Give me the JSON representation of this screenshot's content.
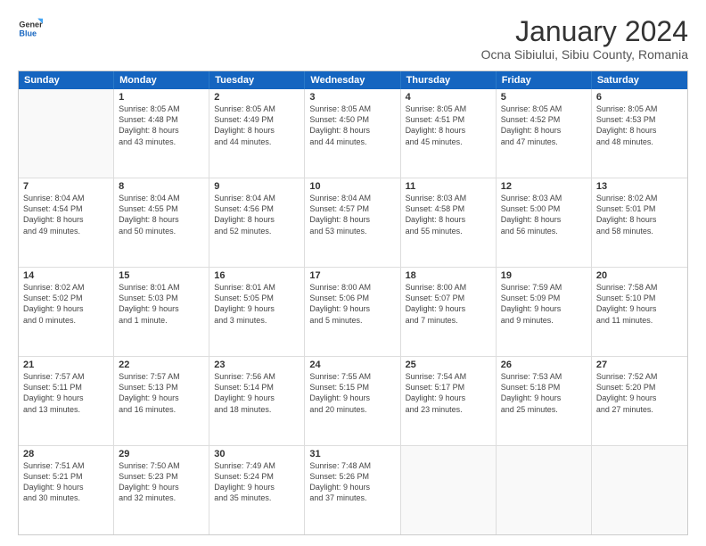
{
  "header": {
    "logo_line1": "General",
    "logo_line2": "Blue",
    "main_title": "January 2024",
    "subtitle": "Ocna Sibiului, Sibiu County, Romania"
  },
  "calendar": {
    "days_of_week": [
      "Sunday",
      "Monday",
      "Tuesday",
      "Wednesday",
      "Thursday",
      "Friday",
      "Saturday"
    ],
    "rows": [
      [
        {
          "day": "",
          "text": ""
        },
        {
          "day": "1",
          "text": "Sunrise: 8:05 AM\nSunset: 4:48 PM\nDaylight: 8 hours\nand 43 minutes."
        },
        {
          "day": "2",
          "text": "Sunrise: 8:05 AM\nSunset: 4:49 PM\nDaylight: 8 hours\nand 44 minutes."
        },
        {
          "day": "3",
          "text": "Sunrise: 8:05 AM\nSunset: 4:50 PM\nDaylight: 8 hours\nand 44 minutes."
        },
        {
          "day": "4",
          "text": "Sunrise: 8:05 AM\nSunset: 4:51 PM\nDaylight: 8 hours\nand 45 minutes."
        },
        {
          "day": "5",
          "text": "Sunrise: 8:05 AM\nSunset: 4:52 PM\nDaylight: 8 hours\nand 47 minutes."
        },
        {
          "day": "6",
          "text": "Sunrise: 8:05 AM\nSunset: 4:53 PM\nDaylight: 8 hours\nand 48 minutes."
        }
      ],
      [
        {
          "day": "7",
          "text": "Sunrise: 8:04 AM\nSunset: 4:54 PM\nDaylight: 8 hours\nand 49 minutes."
        },
        {
          "day": "8",
          "text": "Sunrise: 8:04 AM\nSunset: 4:55 PM\nDaylight: 8 hours\nand 50 minutes."
        },
        {
          "day": "9",
          "text": "Sunrise: 8:04 AM\nSunset: 4:56 PM\nDaylight: 8 hours\nand 52 minutes."
        },
        {
          "day": "10",
          "text": "Sunrise: 8:04 AM\nSunset: 4:57 PM\nDaylight: 8 hours\nand 53 minutes."
        },
        {
          "day": "11",
          "text": "Sunrise: 8:03 AM\nSunset: 4:58 PM\nDaylight: 8 hours\nand 55 minutes."
        },
        {
          "day": "12",
          "text": "Sunrise: 8:03 AM\nSunset: 5:00 PM\nDaylight: 8 hours\nand 56 minutes."
        },
        {
          "day": "13",
          "text": "Sunrise: 8:02 AM\nSunset: 5:01 PM\nDaylight: 8 hours\nand 58 minutes."
        }
      ],
      [
        {
          "day": "14",
          "text": "Sunrise: 8:02 AM\nSunset: 5:02 PM\nDaylight: 9 hours\nand 0 minutes."
        },
        {
          "day": "15",
          "text": "Sunrise: 8:01 AM\nSunset: 5:03 PM\nDaylight: 9 hours\nand 1 minute."
        },
        {
          "day": "16",
          "text": "Sunrise: 8:01 AM\nSunset: 5:05 PM\nDaylight: 9 hours\nand 3 minutes."
        },
        {
          "day": "17",
          "text": "Sunrise: 8:00 AM\nSunset: 5:06 PM\nDaylight: 9 hours\nand 5 minutes."
        },
        {
          "day": "18",
          "text": "Sunrise: 8:00 AM\nSunset: 5:07 PM\nDaylight: 9 hours\nand 7 minutes."
        },
        {
          "day": "19",
          "text": "Sunrise: 7:59 AM\nSunset: 5:09 PM\nDaylight: 9 hours\nand 9 minutes."
        },
        {
          "day": "20",
          "text": "Sunrise: 7:58 AM\nSunset: 5:10 PM\nDaylight: 9 hours\nand 11 minutes."
        }
      ],
      [
        {
          "day": "21",
          "text": "Sunrise: 7:57 AM\nSunset: 5:11 PM\nDaylight: 9 hours\nand 13 minutes."
        },
        {
          "day": "22",
          "text": "Sunrise: 7:57 AM\nSunset: 5:13 PM\nDaylight: 9 hours\nand 16 minutes."
        },
        {
          "day": "23",
          "text": "Sunrise: 7:56 AM\nSunset: 5:14 PM\nDaylight: 9 hours\nand 18 minutes."
        },
        {
          "day": "24",
          "text": "Sunrise: 7:55 AM\nSunset: 5:15 PM\nDaylight: 9 hours\nand 20 minutes."
        },
        {
          "day": "25",
          "text": "Sunrise: 7:54 AM\nSunset: 5:17 PM\nDaylight: 9 hours\nand 23 minutes."
        },
        {
          "day": "26",
          "text": "Sunrise: 7:53 AM\nSunset: 5:18 PM\nDaylight: 9 hours\nand 25 minutes."
        },
        {
          "day": "27",
          "text": "Sunrise: 7:52 AM\nSunset: 5:20 PM\nDaylight: 9 hours\nand 27 minutes."
        }
      ],
      [
        {
          "day": "28",
          "text": "Sunrise: 7:51 AM\nSunset: 5:21 PM\nDaylight: 9 hours\nand 30 minutes."
        },
        {
          "day": "29",
          "text": "Sunrise: 7:50 AM\nSunset: 5:23 PM\nDaylight: 9 hours\nand 32 minutes."
        },
        {
          "day": "30",
          "text": "Sunrise: 7:49 AM\nSunset: 5:24 PM\nDaylight: 9 hours\nand 35 minutes."
        },
        {
          "day": "31",
          "text": "Sunrise: 7:48 AM\nSunset: 5:26 PM\nDaylight: 9 hours\nand 37 minutes."
        },
        {
          "day": "",
          "text": ""
        },
        {
          "day": "",
          "text": ""
        },
        {
          "day": "",
          "text": ""
        }
      ]
    ]
  }
}
